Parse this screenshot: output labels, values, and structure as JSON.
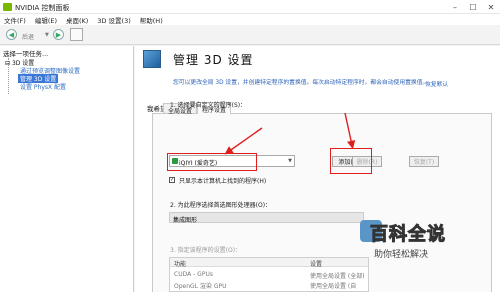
{
  "window": {
    "title": "NVIDIA 控制面板",
    "controls": [
      "minimize-icon",
      "maximize-icon",
      "close-icon"
    ]
  },
  "menu": [
    "文件(F)",
    "编辑(E)",
    "桌面(K)",
    "3D 设置(3)",
    "帮助(H)"
  ],
  "toolbar": {
    "back_label": "后退",
    "icons": [
      "back-arrow-icon",
      "forward-arrow-icon",
      "home-icon"
    ]
  },
  "left_pane": {
    "task_title": "选择一项任务...",
    "root": "3D 设置",
    "children": [
      {
        "label": "通过预览调整图像设置",
        "selected": false
      },
      {
        "label": "管理 3D 设置",
        "selected": true
      },
      {
        "label": "设置 PhysX 配置",
        "selected": false
      }
    ]
  },
  "main": {
    "title": "管理 3D 设置",
    "description": "您可以更改全局 3D 设置，并创建特定程序的置换值。每次启动特定程序时，都会自动使用置换值。",
    "restore_link": "恢复默认",
    "section_label": "我希望使用以下 3D 设置：",
    "tabs": [
      {
        "label": "全局设置",
        "active": false
      },
      {
        "label": "程序设置",
        "active": true
      }
    ],
    "step1_label": "1. 选择要自定义的程序(S)：",
    "program_selected": "iQIYI (爱奇艺)",
    "buttons": {
      "add": "添加(D)",
      "remove": "删除(R)",
      "restore": "恢复(T)"
    },
    "checkbox_label": "只显示本计算机上找到的程序(H)",
    "checkbox_checked": true,
    "step2_label": "2. 为此程序选择首选图形处理器(O)：",
    "processor_value": "集成图形",
    "step3_label": "3. 指定该程序的设置(O)：",
    "table": {
      "headers": [
        "功能",
        "设置"
      ],
      "rows": [
        [
          "CUDA - GPUs",
          "使用全局设置 (全部)"
        ],
        [
          "OpenGL 渲染 GPU",
          "使用全局设置 (自动...)"
        ]
      ]
    }
  },
  "watermark": {
    "title": "百科全说",
    "subtitle": "助你轻松解决"
  },
  "colors": {
    "annotation": "#e01d1d",
    "nvidia_green": "#76b900",
    "selection_blue": "#3b78d6",
    "link_blue": "#2d62b8"
  }
}
